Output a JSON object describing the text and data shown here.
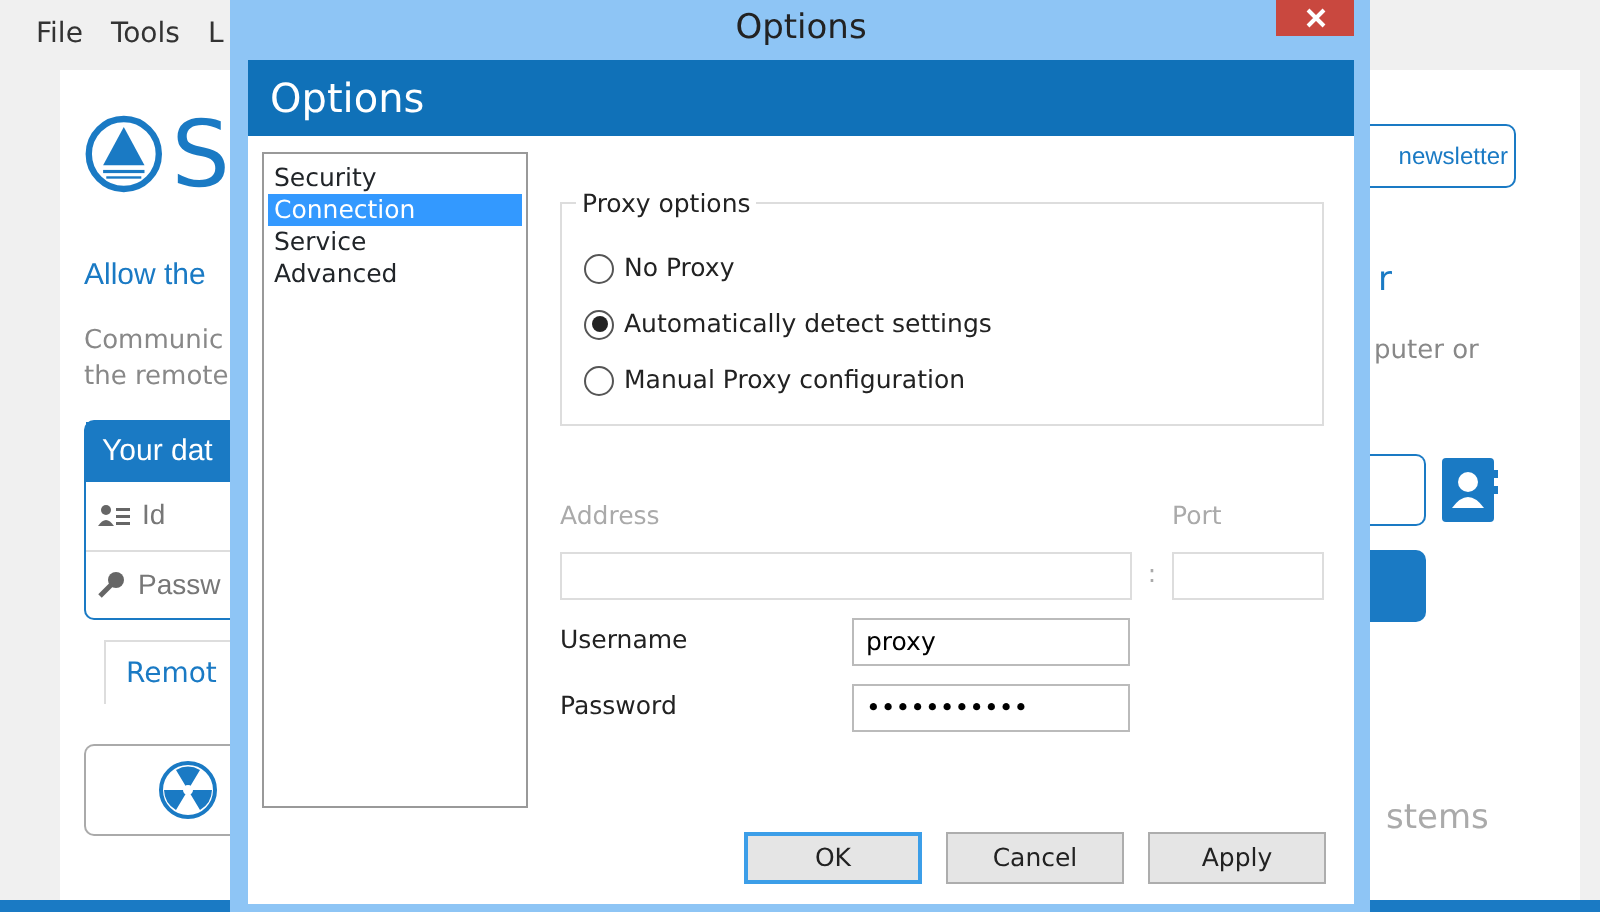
{
  "app": {
    "menu": [
      "File",
      "Tools",
      "L"
    ],
    "logo_letter": "S",
    "newsletter": "newsletter",
    "heading": "Allow the",
    "heading_right": "r",
    "description": [
      "Communic",
      "the remote"
    ],
    "description_right": "puter or",
    "card": {
      "title": "Your dat",
      "fields": [
        {
          "kind": "id",
          "label": "Id"
        },
        {
          "kind": "key",
          "label": "Passw"
        }
      ]
    },
    "tab": "Remot",
    "footer_text": "stems"
  },
  "dialog": {
    "title": "Options",
    "header": "Options",
    "categories": [
      {
        "label": "Security",
        "selected": false
      },
      {
        "label": "Connection",
        "selected": true
      },
      {
        "label": "Service",
        "selected": false
      },
      {
        "label": "Advanced",
        "selected": false
      }
    ],
    "proxy_group": {
      "title": "Proxy options",
      "options": [
        {
          "label": "No Proxy",
          "selected": false
        },
        {
          "label": "Automatically detect settings",
          "selected": true
        },
        {
          "label": "Manual Proxy configuration",
          "selected": false
        }
      ]
    },
    "address": {
      "label": "Address",
      "disabled": true
    },
    "separator": ":",
    "port": {
      "label": "Port",
      "disabled": true
    },
    "username": {
      "label": "Username",
      "value": "proxy"
    },
    "password": {
      "label": "Password",
      "value": "•••••••••••"
    },
    "buttons": [
      {
        "label": "OK",
        "default": true
      },
      {
        "label": "Cancel",
        "default": false
      },
      {
        "label": "Apply",
        "default": false
      }
    ]
  }
}
